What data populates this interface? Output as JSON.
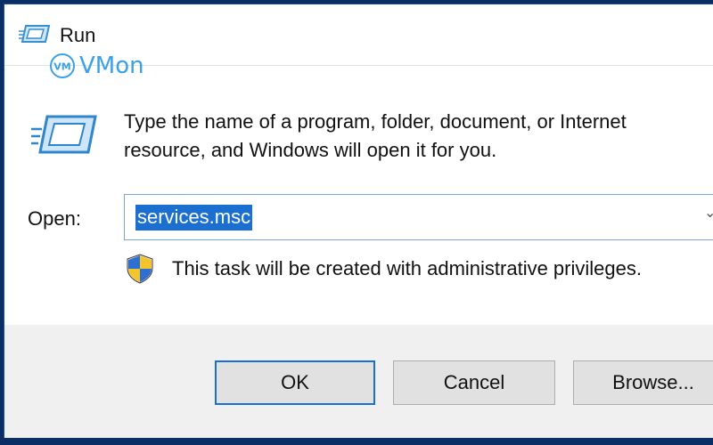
{
  "window": {
    "title": "Run",
    "watermark": "VMon",
    "watermark_logo_text": "VM"
  },
  "description": {
    "line1": "Type the name of a program, folder, document, or Internet",
    "line2": "resource, and Windows will open it for you."
  },
  "open": {
    "label": "Open:",
    "value": "services.msc"
  },
  "admin_notice": "This task will be created with administrative privileges.",
  "buttons": {
    "ok": "OK",
    "cancel": "Cancel",
    "browse": "Browse..."
  },
  "colors": {
    "accent": "#1a6fd1",
    "desktop": "#0b2d66",
    "footer": "#f0f0f0"
  },
  "icons": {
    "title": "run-icon",
    "main": "run-icon",
    "admin": "uac-shield-icon",
    "dropdown": "chevron-down-icon"
  }
}
